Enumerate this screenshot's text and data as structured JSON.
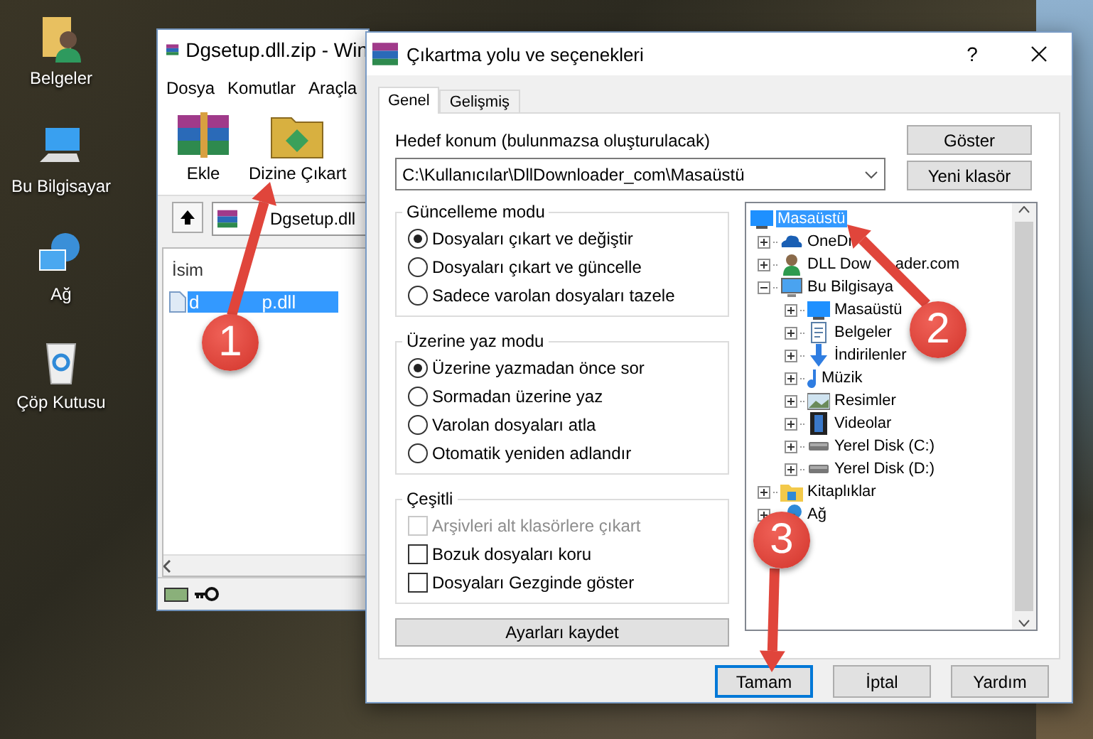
{
  "desktop_icons": [
    {
      "label": "Belgeler",
      "kind": "documents"
    },
    {
      "label": "Bu Bilgisayar",
      "kind": "computer"
    },
    {
      "label": "Ağ",
      "kind": "network"
    },
    {
      "label": "Çöp Kutusu",
      "kind": "recycle"
    }
  ],
  "archive_window": {
    "title": "Dgsetup.dll.zip - Win",
    "menu": [
      "Dosya",
      "Komutlar",
      "Araçla"
    ],
    "toolbar": [
      {
        "label": "Ekle",
        "kind": "add"
      },
      {
        "label": "Dizine Çıkart",
        "kind": "extract"
      }
    ],
    "path": "Dgsetup.dll",
    "columns": [
      "İsim"
    ],
    "files": [
      {
        "name_parts": [
          "d",
          "p.dll"
        ],
        "selected": true
      }
    ]
  },
  "dialog": {
    "title": "Çıkartma yolu ve seçenekleri",
    "help": "?",
    "tabs": [
      {
        "label": "Genel",
        "selected": true
      },
      {
        "label": "Gelişmiş",
        "selected": false
      }
    ],
    "destination_label": "Hedef konum (bulunmazsa oluşturulacak)",
    "destination_value": "C:\\Kullanıcılar\\DllDownloader_com\\Masaüstü",
    "side_buttons": [
      "Göster",
      "Yeni klasör"
    ],
    "groups": [
      {
        "title": "Güncelleme modu",
        "options": [
          {
            "label": "Dosyaları çıkart ve değiştir",
            "kind": "radio",
            "checked": true,
            "disabled": false
          },
          {
            "label": "Dosyaları çıkart ve güncelle",
            "kind": "radio",
            "checked": false,
            "disabled": false
          },
          {
            "label": "Sadece varolan dosyaları tazele",
            "kind": "radio",
            "checked": false,
            "disabled": false
          }
        ]
      },
      {
        "title": "Üzerine yaz modu",
        "options": [
          {
            "label": "Üzerine yazmadan önce sor",
            "kind": "radio",
            "checked": true,
            "disabled": false
          },
          {
            "label": "Sormadan üzerine yaz",
            "kind": "radio",
            "checked": false,
            "disabled": false
          },
          {
            "label": "Varolan dosyaları atla",
            "kind": "radio",
            "checked": false,
            "disabled": false
          },
          {
            "label": "Otomatik yeniden adlandır",
            "kind": "radio",
            "checked": false,
            "disabled": false
          }
        ]
      },
      {
        "title": "Çeşitli",
        "options": [
          {
            "label": "Arşivleri alt klasörlere çıkart",
            "kind": "checkbox",
            "checked": false,
            "disabled": true
          },
          {
            "label": "Bozuk dosyaları koru",
            "kind": "checkbox",
            "checked": false,
            "disabled": false
          },
          {
            "label": "Dosyaları Gezginde göster",
            "kind": "checkbox",
            "checked": false,
            "disabled": false
          }
        ]
      }
    ],
    "save_button": "Ayarları kaydet",
    "tree": {
      "label": "Masaüstü",
      "kind": "desktop",
      "selected": true,
      "children": [
        {
          "label": "OneDr",
          "kind": "cloud",
          "selected": false,
          "expanded": false
        },
        {
          "label": "DLL Dow",
          "label_after": "ader.com",
          "kind": "user",
          "selected": false,
          "expanded": false
        },
        {
          "label": "Bu Bilgisaya",
          "kind": "computer",
          "selected": false,
          "expanded": true,
          "children": [
            {
              "label": "Masaüstü",
              "kind": "desktop",
              "selected": false,
              "expanded": false
            },
            {
              "label": "Belgeler",
              "kind": "documents",
              "selected": false,
              "expanded": false
            },
            {
              "label": "İndirilenler",
              "kind": "download",
              "selected": false,
              "expanded": false
            },
            {
              "label": "Müzik",
              "kind": "music",
              "selected": false,
              "expanded": false
            },
            {
              "label": "Resimler",
              "kind": "pictures",
              "selected": false,
              "expanded": false
            },
            {
              "label": "Videolar",
              "kind": "video",
              "selected": false,
              "expanded": false
            },
            {
              "label": "Yerel Disk (C:)",
              "kind": "drive",
              "selected": false,
              "expanded": false
            },
            {
              "label": "Yerel Disk (D:)",
              "kind": "drive",
              "selected": false,
              "expanded": false
            }
          ]
        },
        {
          "label": "Kitaplıklar",
          "kind": "library",
          "selected": false,
          "expanded": false
        },
        {
          "label": "Ağ",
          "kind": "network",
          "selected": false,
          "expanded": false
        }
      ]
    },
    "buttons": [
      {
        "label": "Tamam",
        "default": true
      },
      {
        "label": "İptal",
        "default": false
      },
      {
        "label": "Yardım",
        "default": false
      }
    ]
  },
  "annotations": [
    {
      "number": "1"
    },
    {
      "number": "2"
    },
    {
      "number": "3"
    }
  ]
}
